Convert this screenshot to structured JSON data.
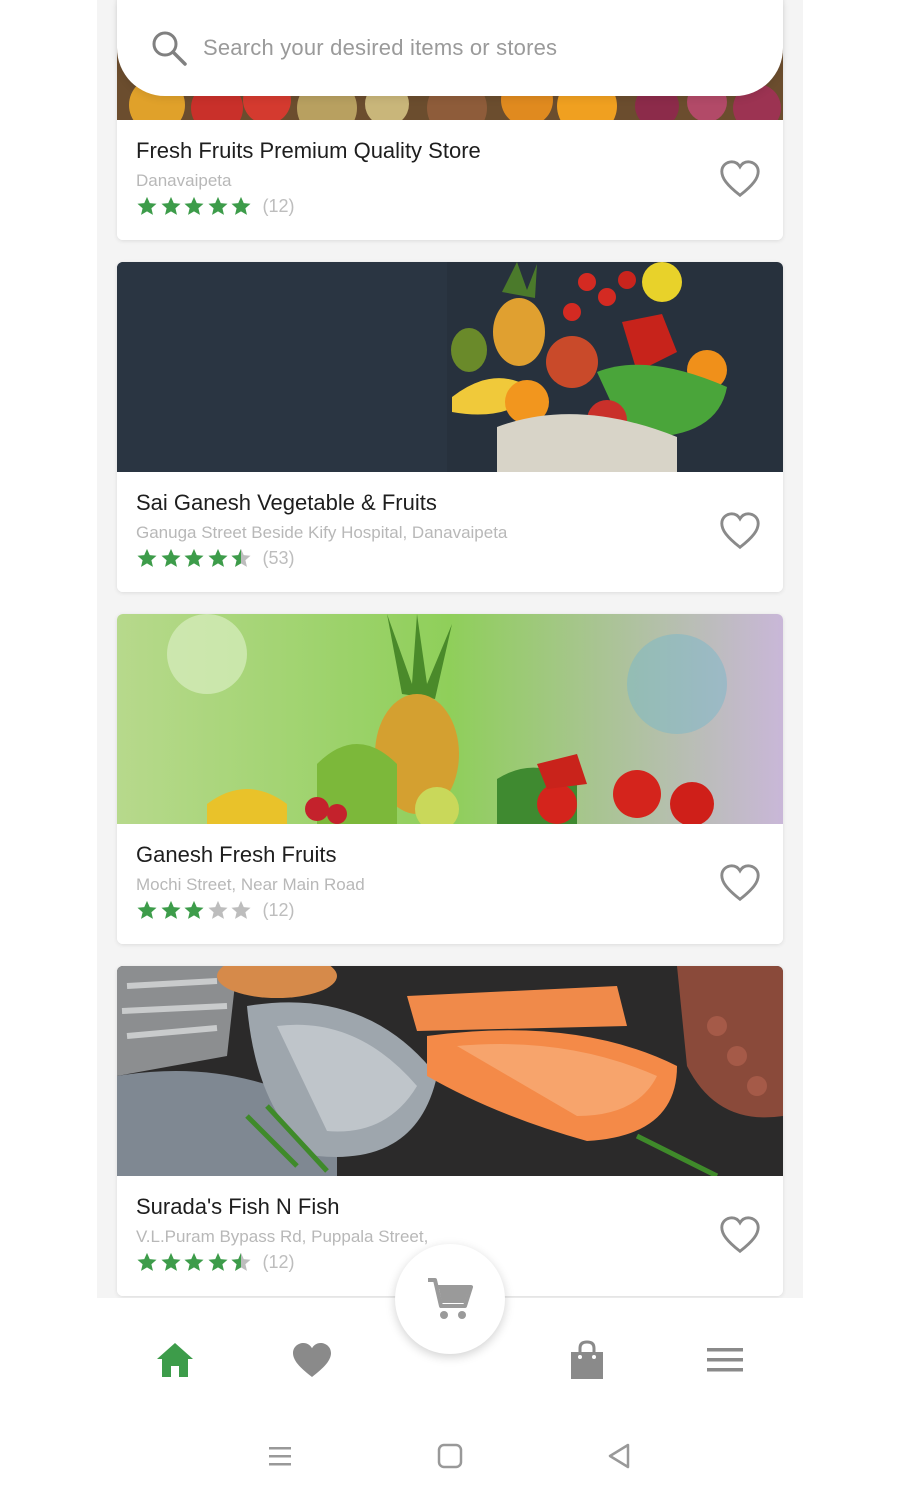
{
  "search": {
    "placeholder": "Search your desired items or stores"
  },
  "stores": [
    {
      "name": "Fresh Fruits Premium Quality Store",
      "address": "Danavaipeta",
      "rating": 5,
      "reviews": "(12)",
      "image": "fruit-banner"
    },
    {
      "name": "Sai Ganesh Vegetable & Fruits",
      "address": "Ganuga Street Beside Kify Hospital, Danavaipeta",
      "rating": 4.5,
      "reviews": "(53)",
      "image": "produce-on-slate"
    },
    {
      "name": "Ganesh Fresh Fruits",
      "address": "Mochi Street, Near Main Road",
      "rating": 3,
      "reviews": "(12)",
      "image": "pineapple-tomatoes"
    },
    {
      "name": "Surada's Fish N Fish",
      "address": "V.L.Puram Bypass Rd, Puppala Street,",
      "rating": 4.5,
      "reviews": "(12)",
      "image": "fish-salmon"
    }
  ],
  "bottom_nav": {
    "items": [
      {
        "icon": "home-icon",
        "active": true
      },
      {
        "icon": "heart-icon",
        "active": false
      },
      {
        "icon": "cart-icon",
        "active": false
      },
      {
        "icon": "shopping-bag-icon",
        "active": false
      },
      {
        "icon": "menu-icon",
        "active": false
      }
    ]
  },
  "colors": {
    "accent": "#3d9c4a",
    "star_filled": "#3d9c4a",
    "star_empty": "#bdbdbd",
    "icon_grey": "#8a8a8a"
  }
}
